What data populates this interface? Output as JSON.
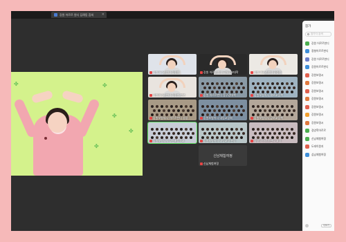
{
  "window": {
    "tab_title": "강원 어르르 원디 답례동 참외",
    "tab_close": "×"
  },
  "stage": {
    "leaf_glyph": "✤"
  },
  "grid": {
    "tiles": [
      {
        "label": "강원어르르한디 감정현",
        "kind": "portrait",
        "scene_color": "#dfe3ea"
      },
      {
        "label": "강원 어르르원디 공개정보대학",
        "kind": "portrait",
        "scene_color": "#2a2a2a"
      },
      {
        "label": "강원 어르르한디 류정민",
        "kind": "portrait",
        "scene_color": "#ece9e4"
      },
      {
        "label": "강원어르르한디 감정현 한분",
        "kind": "portrait",
        "scene_color": "#e9e4df"
      },
      {
        "label": "강원 어르르한디 동구강대책",
        "kind": "class",
        "scene_color": "#8a9aa6"
      },
      {
        "label": "강원보령어시 채보교정책",
        "kind": "class",
        "scene_color": "#9fb3c1"
      },
      {
        "label": "강원보령대시 어르르한디 성장",
        "kind": "class",
        "scene_color": "#a89a86"
      },
      {
        "label": "강원보령어시 내림교정회",
        "kind": "class",
        "scene_color": "#7d8fa0"
      },
      {
        "label": "강원보령다시 공보교정책",
        "kind": "class",
        "scene_color": "#b3a79a"
      },
      {
        "label": "강원보령다시 장선초등학교",
        "kind": "class",
        "scene_color": "#c7ccd6",
        "active": true
      },
      {
        "label": "강원보령어시 내림교정 한장",
        "kind": "class",
        "scene_color": "#b9c6c8"
      },
      {
        "label": "경양학 어르르한디 교정",
        "kind": "class",
        "scene_color": "#c9bcc0"
      },
      {
        "label": "",
        "kind": "none"
      },
      {
        "label": "신남체험여정",
        "bigname": "신남체험여정",
        "kind": "empty"
      },
      {
        "label": "",
        "kind": "none"
      }
    ]
  },
  "sidebar": {
    "title": "참가",
    "count": "",
    "search_placeholder": "참가자 검색",
    "items": [
      {
        "name": "강원 어르르한디",
        "color": "#4caf50"
      },
      {
        "name": "정형어르르한디",
        "color": "#3f8fd9"
      },
      {
        "name": "강원 어르르한디",
        "color": "#6b7ec9"
      },
      {
        "name": "강원어르르한디",
        "color": "#3f8fd9"
      },
      {
        "name": "강원보령시",
        "color": "#e0614f"
      },
      {
        "name": "강원보령시",
        "color": "#e07a3f"
      },
      {
        "name": "강원보령시",
        "color": "#e0614f"
      },
      {
        "name": "강원보령시",
        "color": "#e07a3f"
      },
      {
        "name": "강원보령시",
        "color": "#e0614f"
      },
      {
        "name": "강원보령시",
        "color": "#f0a030"
      },
      {
        "name": "강원보령시",
        "color": "#e07a3f"
      },
      {
        "name": "경양학어르르",
        "color": "#4caf50"
      },
      {
        "name": "신남체험여정",
        "color": "#4caf50"
      },
      {
        "name": "도래이원자",
        "color": "#e0614f"
      },
      {
        "name": "심남체험여정",
        "color": "#3f8fd9"
      }
    ],
    "footer_button": "더보기"
  }
}
